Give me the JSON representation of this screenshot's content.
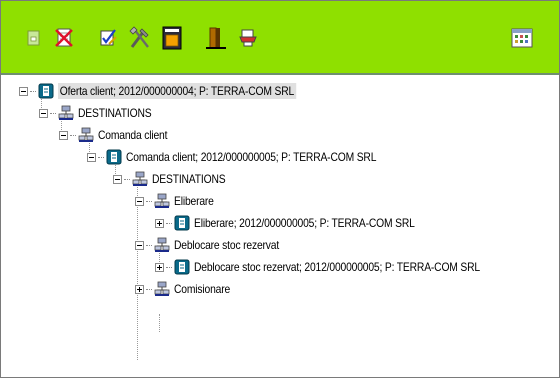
{
  "toolbar": {
    "background": "#8fe000",
    "buttons": [
      {
        "name": "document-icon"
      },
      {
        "name": "delete-document-icon"
      },
      {
        "name": "edit-check-icon"
      },
      {
        "name": "tools-icon"
      },
      {
        "name": "window-icon"
      },
      {
        "name": "exit-door-icon"
      },
      {
        "name": "print-icon"
      },
      {
        "name": "calendar-icon"
      }
    ]
  },
  "tree": {
    "nodes": [
      {
        "label": "Oferta client; 2012/000000004; P: TERRA-COM SRL",
        "icon": "document-icon",
        "toggle": "minus"
      },
      {
        "label": "DESTINATIONS",
        "icon": "network-icon",
        "toggle": "minus"
      },
      {
        "label": "Comanda client",
        "icon": "network-icon",
        "toggle": "minus"
      },
      {
        "label": "Comanda client; 2012/000000005; P: TERRA-COM SRL",
        "icon": "document-icon",
        "toggle": "minus"
      },
      {
        "label": "DESTINATIONS",
        "icon": "network-icon",
        "toggle": "minus"
      },
      {
        "label": "Eliberare",
        "icon": "network-icon",
        "toggle": "minus"
      },
      {
        "label": "Eliberare; 2012/000000005; P: TERRA-COM SRL",
        "icon": "document-icon",
        "toggle": "plus"
      },
      {
        "label": "Deblocare stoc rezervat",
        "icon": "network-icon",
        "toggle": "minus"
      },
      {
        "label": "Deblocare stoc rezervat; 2012/000000005; P: TERRA-COM SRL",
        "icon": "document-icon",
        "toggle": "plus"
      },
      {
        "label": "Comisionare",
        "icon": "network-icon",
        "toggle": "plus"
      }
    ]
  }
}
